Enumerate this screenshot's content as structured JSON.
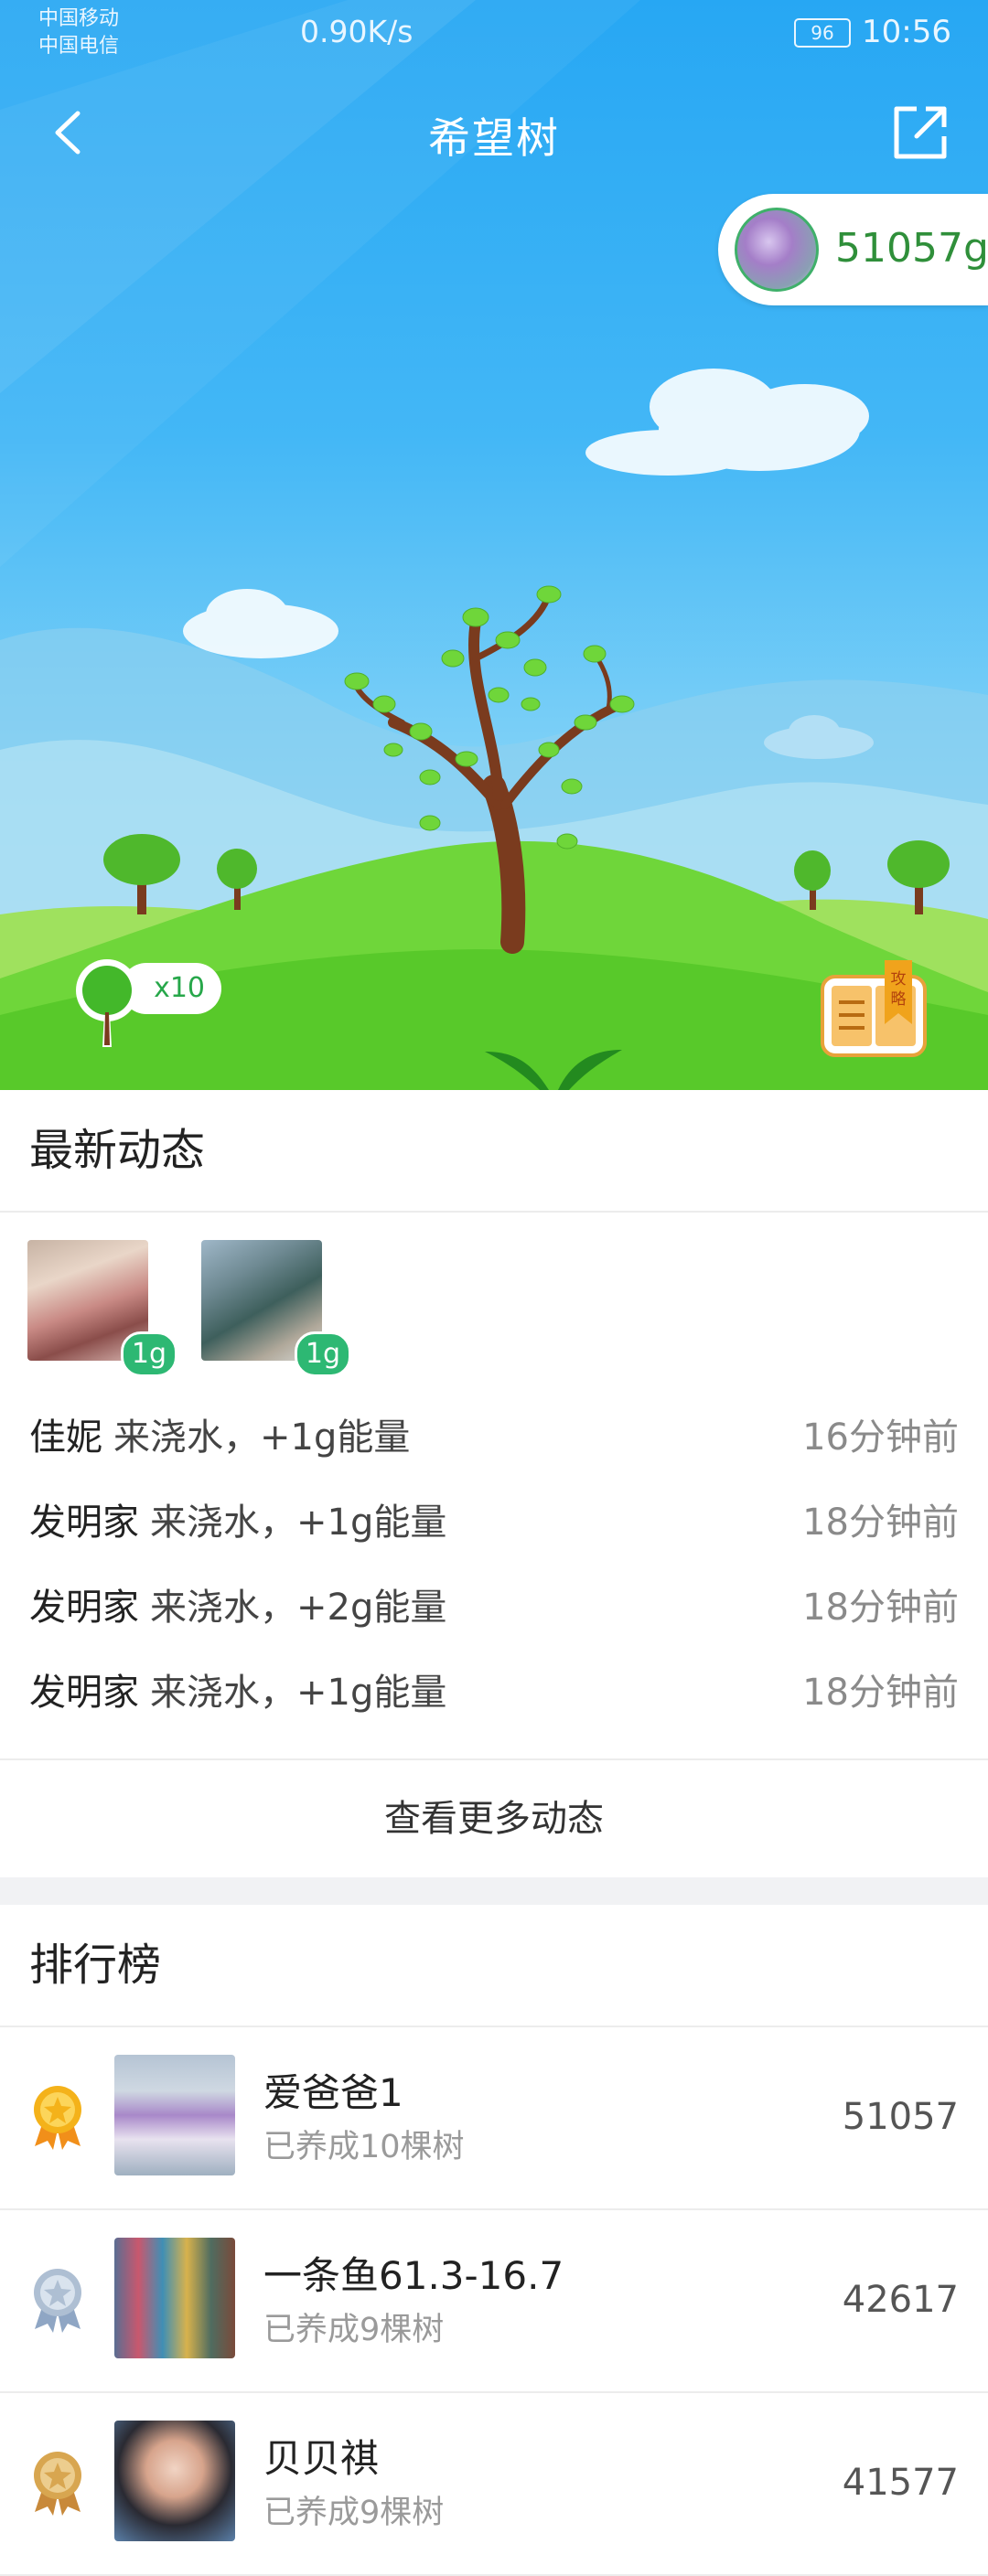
{
  "status_bar": {
    "carrier_1": "中国移动",
    "carrier_2": "中国电信",
    "net_speed": "0.90K/s",
    "battery": "96",
    "time": "10:56"
  },
  "header": {
    "title": "希望树"
  },
  "energy": {
    "value": "51057g"
  },
  "tree_count": {
    "label": "x10"
  },
  "guide": {
    "label": "攻略"
  },
  "feed": {
    "heading": "最新动态",
    "badges": [
      "1g",
      "1g"
    ],
    "items": [
      {
        "name": "佳妮",
        "action": "来浇水，+1g能量",
        "time": "16分钟前"
      },
      {
        "name": "发明家",
        "action": "来浇水，+1g能量",
        "time": "18分钟前"
      },
      {
        "name": "发明家",
        "action": "来浇水，+2g能量",
        "time": "18分钟前"
      },
      {
        "name": "发明家",
        "action": "来浇水，+1g能量",
        "time": "18分钟前"
      }
    ],
    "more_label": "查看更多动态"
  },
  "ranking": {
    "heading": "排行榜",
    "rows": [
      {
        "name": "爱爸爸1",
        "sub": "已养成10棵树",
        "score": "51057",
        "medal": "gold"
      },
      {
        "name": "一条鱼61.3-16.7",
        "sub": "已养成9棵树",
        "score": "42617",
        "medal": "silver"
      },
      {
        "name": "贝贝祺",
        "sub": "已养成9棵树",
        "score": "41577",
        "medal": "bronze"
      }
    ]
  },
  "colors": {
    "sky_top": "#27a7f3",
    "grass": "#5fd12e",
    "badge_green": "#2db873",
    "gold": "#f4b21a",
    "silver": "#aebfd3",
    "bronze": "#d8a650"
  }
}
